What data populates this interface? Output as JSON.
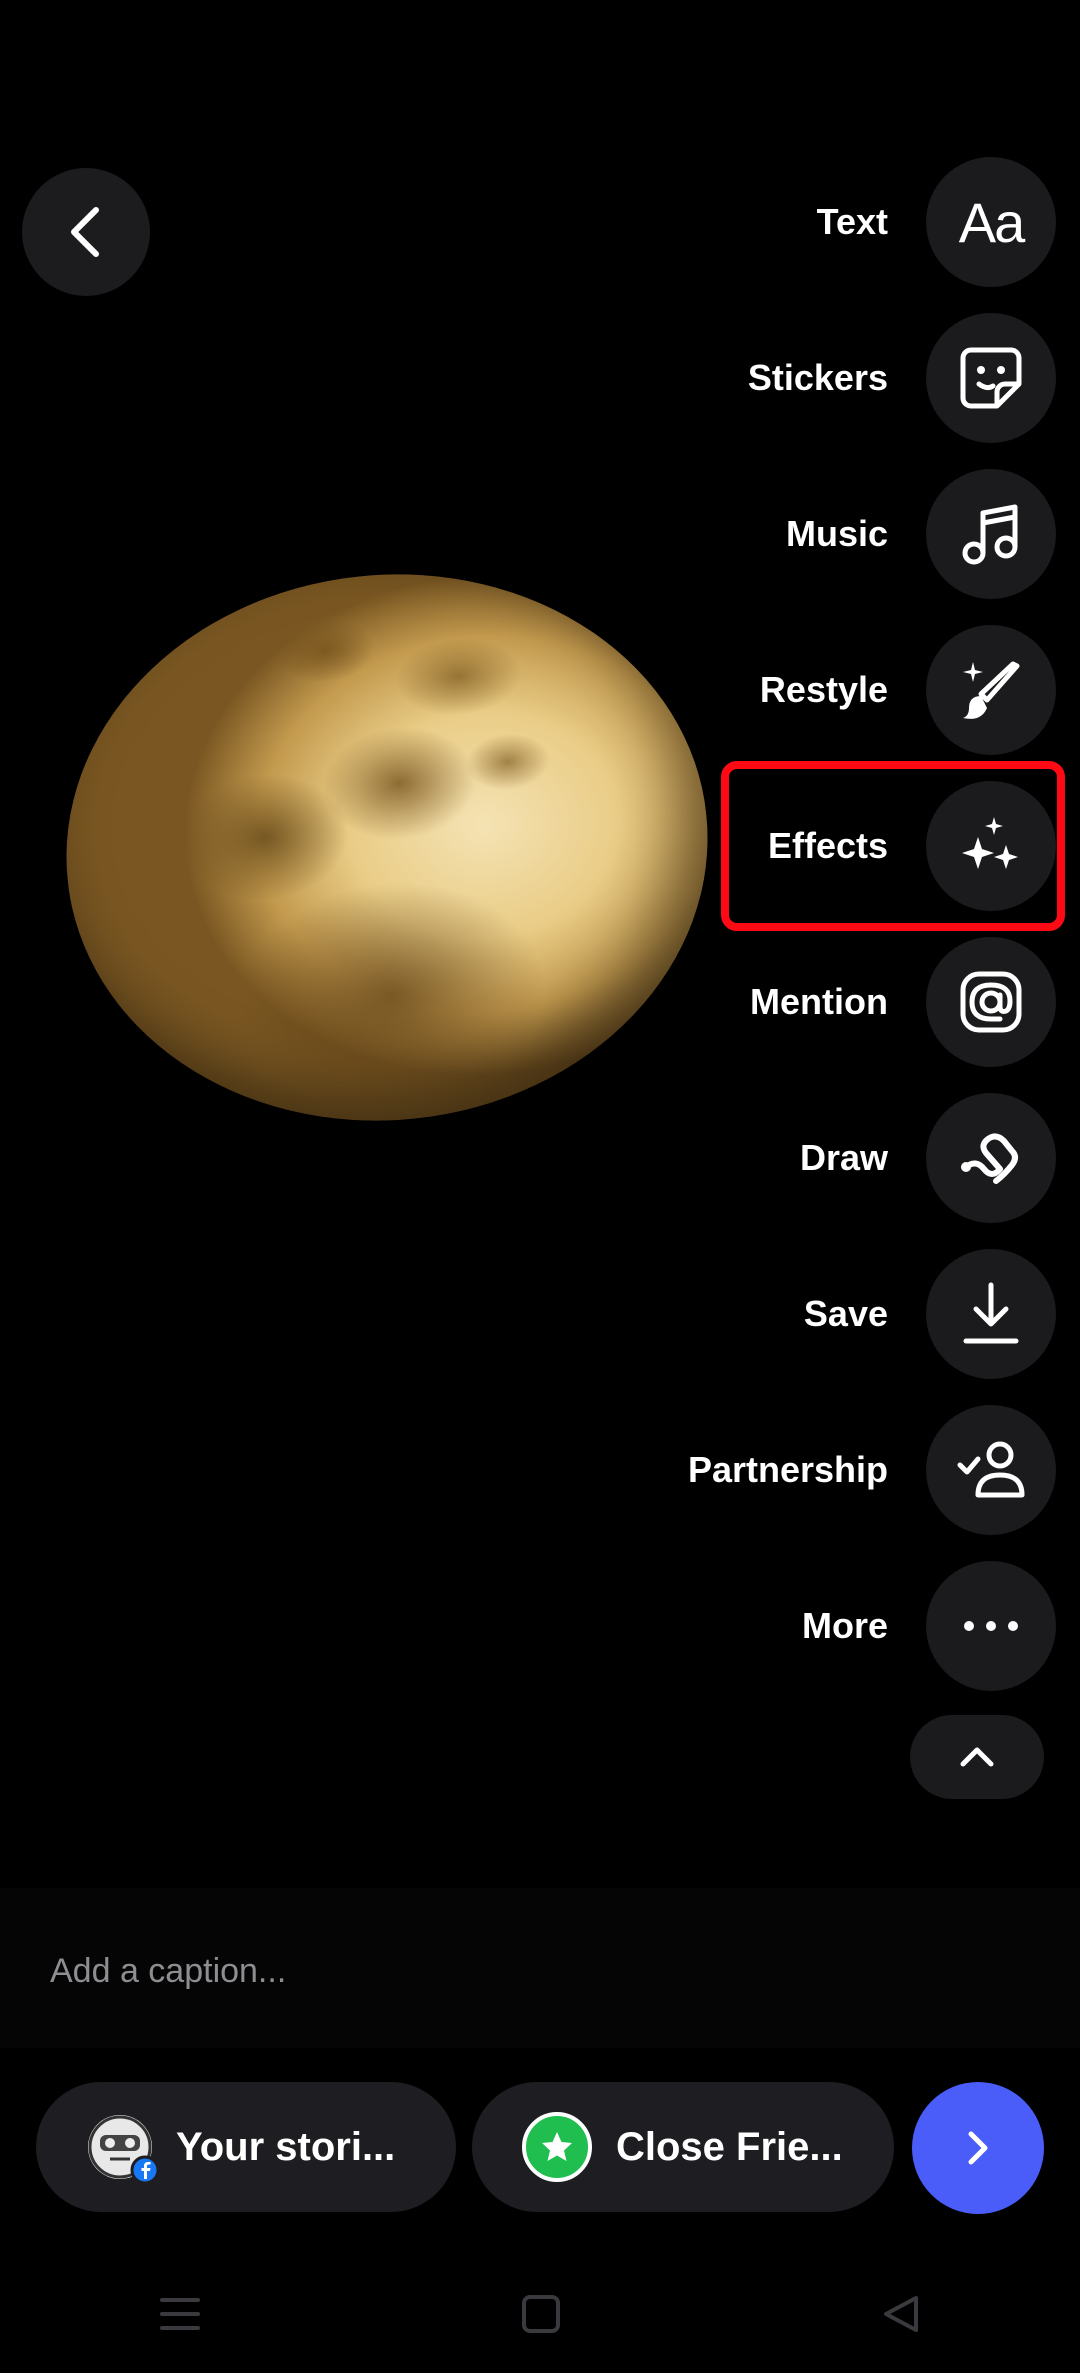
{
  "tools": [
    {
      "label": "Text",
      "icon": "text-aa-icon",
      "glyph": "Aa"
    },
    {
      "label": "Stickers",
      "icon": "sticker-icon"
    },
    {
      "label": "Music",
      "icon": "music-note-icon"
    },
    {
      "label": "Restyle",
      "icon": "brush-sparkle-icon"
    },
    {
      "label": "Effects",
      "icon": "sparkles-icon"
    },
    {
      "label": "Mention",
      "icon": "at-sign-icon"
    },
    {
      "label": "Draw",
      "icon": "squiggle-icon"
    },
    {
      "label": "Save",
      "icon": "download-icon"
    },
    {
      "label": "Partnership",
      "icon": "person-check-icon"
    },
    {
      "label": "More",
      "icon": "more-dots-icon"
    }
  ],
  "caption": {
    "placeholder": "Add a caption..."
  },
  "share": {
    "your_stories": "Your stori...",
    "close_friends": "Close Frie..."
  },
  "colors": {
    "highlight": "#ff0a14",
    "next_button": "#4a5df9",
    "close_friends_green": "#1fbe4f"
  }
}
